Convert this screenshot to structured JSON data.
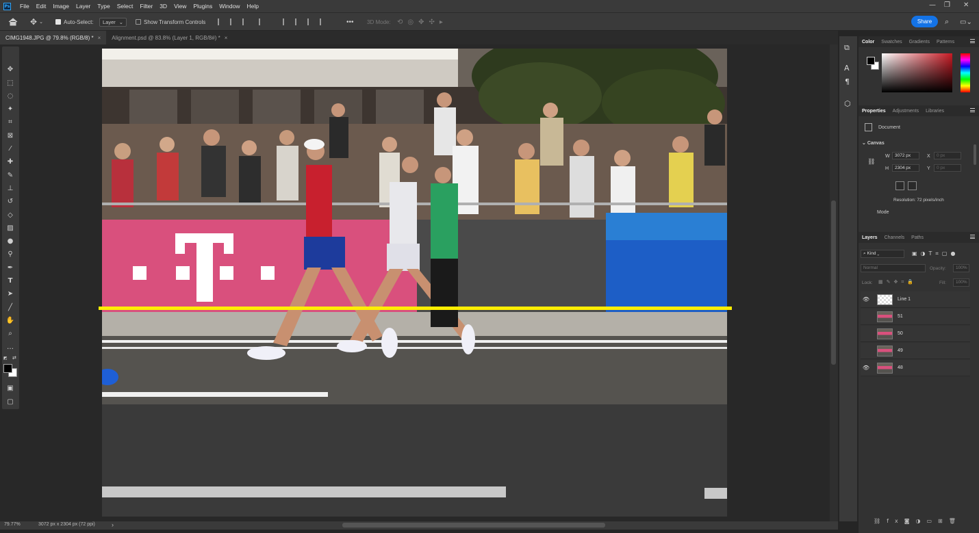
{
  "menu": [
    "File",
    "Edit",
    "Image",
    "Layer",
    "Type",
    "Select",
    "Filter",
    "3D",
    "View",
    "Plugins",
    "Window",
    "Help"
  ],
  "app_icon": "Ps",
  "options": {
    "auto_select_label": "Auto-Select:",
    "auto_select_target": "Layer",
    "show_transform_label": "Show Transform Controls",
    "mode_3d_label": "3D Mode:",
    "more": "•••",
    "share_label": "Share"
  },
  "tabs": [
    {
      "label": "CIMG1948.JPG @ 79.8% (RGB/8) *",
      "close": "×"
    },
    {
      "label": "Alignment.psd @ 83.8% (Layer 1, RGB/8#) *",
      "close": "×"
    }
  ],
  "status": {
    "zoom": "79.77%",
    "doc_info": "3072 px x 2304 px (72 ppi)",
    "arrow": "›"
  },
  "color_panel": {
    "tabs": [
      "Color",
      "Swatches",
      "Gradients",
      "Patterns"
    ],
    "foreground": "#000000",
    "background": "#ffffff",
    "hue": "#c81a24"
  },
  "properties_panel": {
    "tabs": [
      "Properties",
      "Adjustments",
      "Libraries"
    ],
    "doc_label": "Document",
    "section": "Canvas",
    "w_label": "W",
    "w_value": "3072 px",
    "h_label": "H",
    "h_value": "2304 px",
    "x_label": "X",
    "x_value": "0 px",
    "y_label": "Y",
    "y_value": "0 px",
    "resolution": "Resolution: 72 pixels/inch",
    "mode_label": "Mode"
  },
  "layers_panel": {
    "tabs": [
      "Layers",
      "Channels",
      "Paths"
    ],
    "filter_kind": "Kind",
    "blend_mode": "Normal",
    "opacity_label": "Opacity:",
    "opacity_value": "100%",
    "lock_label": "Lock:",
    "fill_label": "Fill:",
    "fill_value": "100%",
    "layers": [
      {
        "name": "Line 1",
        "visible": true
      },
      {
        "name": "51",
        "visible": false
      },
      {
        "name": "50",
        "visible": false
      },
      {
        "name": "49",
        "visible": false
      },
      {
        "name": "48",
        "visible": true
      }
    ]
  },
  "overlay": {
    "line_color": "#ffee00"
  }
}
